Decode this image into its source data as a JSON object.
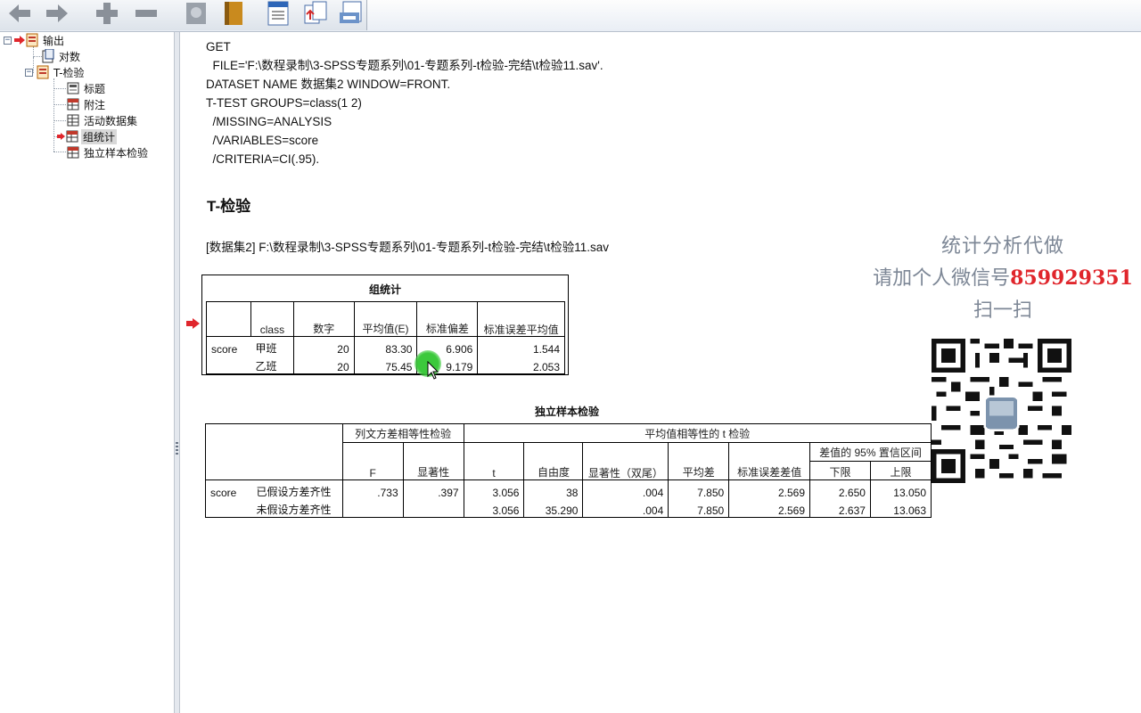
{
  "toolbar": {
    "buttons": [
      "back-icon",
      "forward-icon",
      "expand-icon",
      "collapse-icon",
      "designate-window-icon",
      "book-icon",
      "export-icon",
      "insert-icon",
      "print-preview-icon"
    ]
  },
  "navigator": {
    "root": "输出",
    "items": [
      {
        "label": "对数"
      },
      {
        "label": "T-检验"
      },
      {
        "label": "标题"
      },
      {
        "label": "附注"
      },
      {
        "label": "活动数据集"
      },
      {
        "label": "组统计"
      },
      {
        "label": "独立样本检验"
      }
    ]
  },
  "syntax": [
    "GET",
    "  FILE='F:\\数程录制\\3-SPSS专题系列\\01-专题系列-t检验-完结\\t检验11.sav'.",
    "DATASET NAME 数据集2 WINDOW=FRONT.",
    "T-TEST GROUPS=class(1 2)",
    "  /MISSING=ANALYSIS",
    "  /VARIABLES=score",
    "  /CRITERIA=CI(.95)."
  ],
  "section_title": "T-检验",
  "dataset_line": "[数据集2] F:\\数程录制\\3-SPSS专题系列\\01-专题系列-t检验-完结\\t检验11.sav",
  "group_stats": {
    "title": "组统计",
    "headers": {
      "class": "class",
      "n": "数字",
      "mean": "平均值(E)",
      "sd": "标准偏差",
      "se": "标准误差平均值"
    },
    "var": "score",
    "rows": [
      {
        "group": "甲班",
        "n": "20",
        "mean": "83.30",
        "sd": "6.906",
        "se": "1.544"
      },
      {
        "group": "乙班",
        "n": "20",
        "mean": "75.45",
        "sd": "9.179",
        "se": "2.053"
      }
    ]
  },
  "indep_test": {
    "title": "独立样本检验",
    "levene_header": "列文方差相等性检验",
    "ttest_header": "平均值相等性的 t 检验",
    "ci_header": "差值的 95% 置信区间",
    "cols": {
      "F": "F",
      "sig": "显著性",
      "t": "t",
      "df": "自由度",
      "sig2": "显著性（双尾）",
      "md": "平均差",
      "sed": "标准误差差值",
      "lower": "下限",
      "upper": "上限"
    },
    "var": "score",
    "rows": [
      {
        "label": "已假设方差齐性",
        "F": ".733",
        "sig": ".397",
        "t": "3.056",
        "df": "38",
        "sig2": ".004",
        "md": "7.850",
        "sed": "2.569",
        "lower": "2.650",
        "upper": "13.050"
      },
      {
        "label": "未假设方差齐性",
        "F": "",
        "sig": "",
        "t": "3.056",
        "df": "35.290",
        "sig2": ".004",
        "md": "7.850",
        "sed": "2.569",
        "lower": "2.637",
        "upper": "13.063"
      }
    ]
  },
  "watermark": {
    "line1": "统计分析代做",
    "line2_prefix": "请加个人微信号",
    "line2_number": "859929351",
    "line3": "扫一扫"
  }
}
